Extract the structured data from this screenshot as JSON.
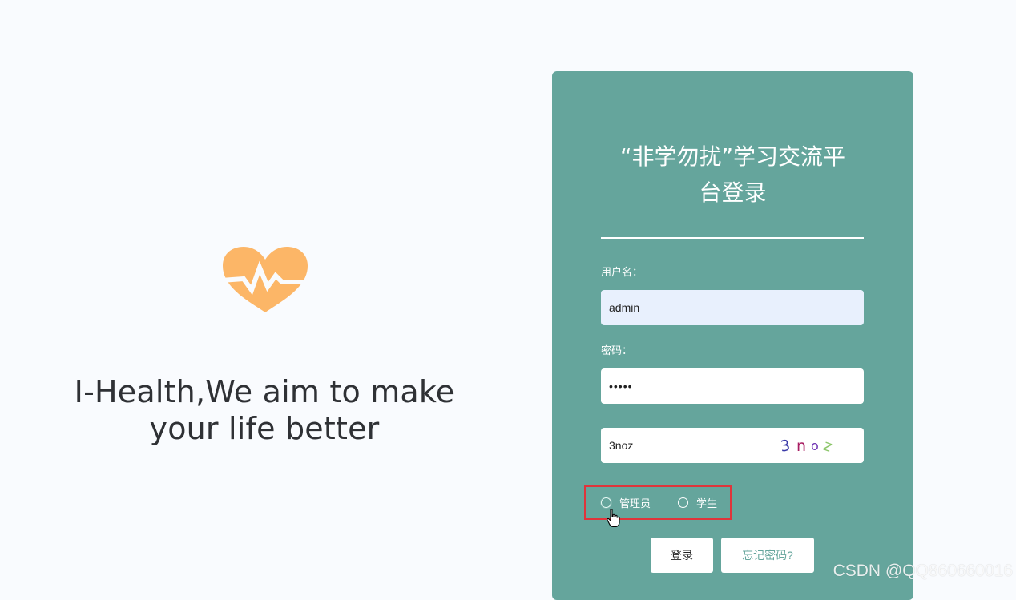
{
  "brand": {
    "logo_icon": "heart-pulse-icon",
    "logo_color": "#fcb667",
    "tagline_line1": "I-Health,We aim to make",
    "tagline_line2": "your life better"
  },
  "login": {
    "card_color": "#65a59c",
    "title_line1": "“非学勿扰”学习交流平",
    "title_line2": "台登录",
    "username_label": "用户名：",
    "username_value": "admin",
    "password_label": "密码：",
    "password_value": "•••••",
    "captcha_value": "3noz",
    "captcha_chars": [
      "3",
      "n",
      "o",
      "z"
    ],
    "roles": [
      {
        "label": "管理员"
      },
      {
        "label": "学生"
      }
    ],
    "login_button": "登录",
    "forgot_button": "忘记密码?"
  },
  "watermark": "CSDN @QQ860660016"
}
